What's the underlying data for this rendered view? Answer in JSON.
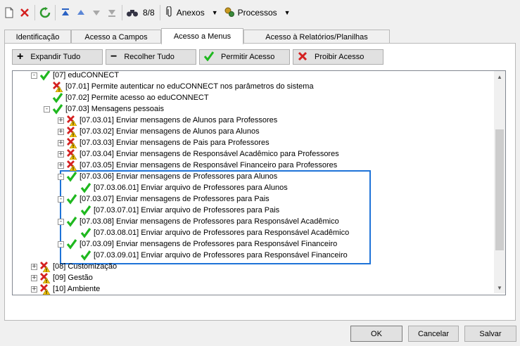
{
  "toolbar": {
    "counter": "8/8",
    "anexos": "Anexos",
    "processos": "Processos"
  },
  "tabs": [
    "Identificação",
    "Acesso a Campos",
    "Acesso a Menus",
    "Acesso à Relatórios/Planilhas"
  ],
  "actions": {
    "expand": "Expandir Tudo",
    "collapse": "Recolher Tudo",
    "allow": "Permitir Acesso",
    "deny": "Proibir Acesso"
  },
  "tree": [
    {
      "label": "[07] eduCONNECT",
      "status": "allowed",
      "expander": "-"
    },
    {
      "label": "[07.01] Permite autenticar no eduCONNECT nos parâmetros do sistema",
      "status": "denied",
      "expander": ""
    },
    {
      "label": "[07.02] Permite acesso ao eduCONNECT",
      "status": "allowed",
      "expander": ""
    },
    {
      "label": "[07.03] Mensagens pessoais",
      "status": "allowed",
      "expander": "-"
    },
    {
      "label": "[07.03.01] Enviar mensagens de Alunos para Professores",
      "status": "denied",
      "expander": "+"
    },
    {
      "label": "[07.03.02] Enviar mensagens de Alunos para Alunos",
      "status": "denied",
      "expander": "+"
    },
    {
      "label": "[07.03.03] Enviar mensagens de Pais para Professores",
      "status": "denied",
      "expander": "+"
    },
    {
      "label": "[07.03.04] Enviar mensagens de Responsável Acadêmico para Professores",
      "status": "denied",
      "expander": "+"
    },
    {
      "label": "[07.03.05] Enviar mensagens de Responsável Financeiro para Professores",
      "status": "denied",
      "expander": "+"
    },
    {
      "label": "[07.03.06] Enviar mensagens de Professores para Alunos",
      "status": "allowed",
      "expander": "-"
    },
    {
      "label": "[07.03.06.01] Enviar arquivo de Professores para Alunos",
      "status": "allowed",
      "expander": ""
    },
    {
      "label": "[07.03.07] Enviar mensagens de Professores para Pais",
      "status": "allowed",
      "expander": "-"
    },
    {
      "label": "[07.03.07.01] Enviar arquivo de Professores para Pais",
      "status": "allowed",
      "expander": ""
    },
    {
      "label": "[07.03.08] Enviar mensagens de Professores para Responsável Acadêmico",
      "status": "allowed",
      "expander": "-"
    },
    {
      "label": "[07.03.08.01] Enviar arquivo de Professores para Responsável Acadêmico",
      "status": "allowed",
      "expander": ""
    },
    {
      "label": "[07.03.09] Enviar mensagens de Professores para Responsável Financeiro",
      "status": "allowed",
      "expander": "-"
    },
    {
      "label": "[07.03.09.01] Enviar arquivo de Professores para Responsável Financeiro",
      "status": "allowed",
      "expander": ""
    },
    {
      "label": "[08] Customização",
      "status": "denied",
      "expander": "+"
    },
    {
      "label": "[09] Gestão",
      "status": "denied",
      "expander": "+"
    },
    {
      "label": "[10] Ambiente",
      "status": "denied",
      "expander": "+"
    }
  ],
  "buttons": {
    "ok": "OK",
    "cancel": "Cancelar",
    "save": "Salvar"
  }
}
